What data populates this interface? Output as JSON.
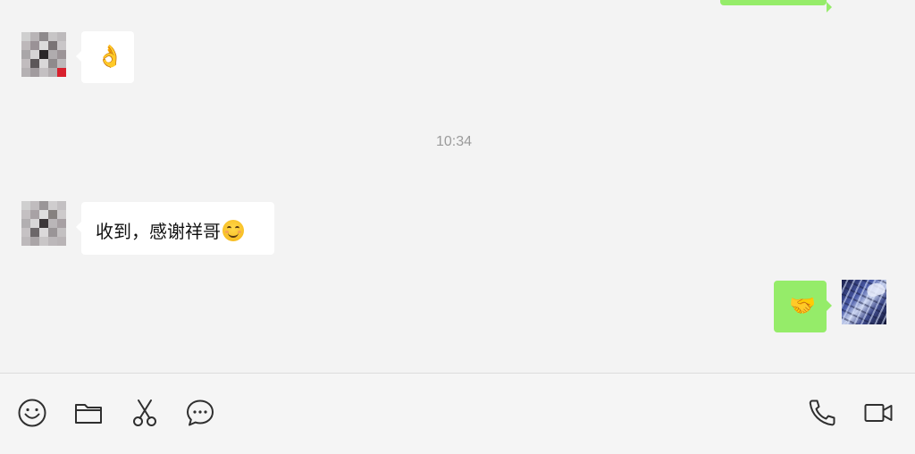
{
  "chat": {
    "messages": [
      {
        "side": "left",
        "type": "emoji",
        "content": "👌"
      },
      {
        "side": "left",
        "type": "text",
        "content": "收到，感谢祥哥"
      },
      {
        "side": "right",
        "type": "emoji",
        "content": "🤝"
      }
    ],
    "timestamp": "10:34"
  },
  "colors": {
    "background": "#f3f3f3",
    "bubble_left": "#ffffff",
    "bubble_right": "#95ec69",
    "timestamp": "#9b9b9b",
    "icon": "#2f2f2f"
  },
  "toolbar": {
    "left_icons": [
      "emoji-icon",
      "folder-icon",
      "scissors-icon",
      "chat-history-icon"
    ],
    "right_icons": [
      "phone-icon",
      "video-icon"
    ]
  }
}
